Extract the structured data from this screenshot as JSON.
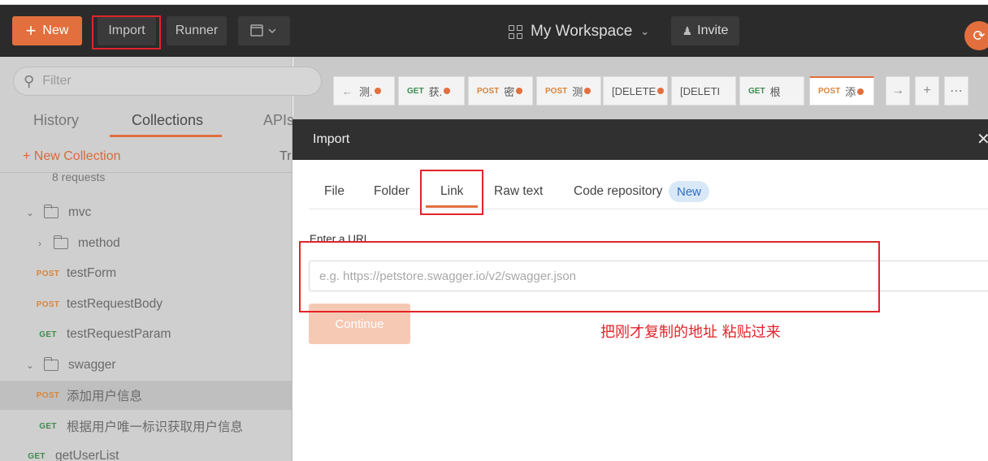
{
  "toolbar": {
    "new_label": "New",
    "import_label": "Import",
    "runner_label": "Runner",
    "workspace_label": "My Workspace",
    "invite_label": "Invite"
  },
  "sidebar": {
    "filter_placeholder": "Filter",
    "tabs": [
      "History",
      "Collections",
      "APIs"
    ],
    "new_collection_label": "+ New Collection",
    "trash_label": "Tr",
    "request_count": "8 requests",
    "items": [
      {
        "type": "folder",
        "label": "mvc",
        "expanded": true
      },
      {
        "type": "folder",
        "label": "method",
        "expanded": false
      },
      {
        "type": "request",
        "method": "POST",
        "label": "testForm"
      },
      {
        "type": "request",
        "method": "POST",
        "label": "testRequestBody"
      },
      {
        "type": "request",
        "method": "GET",
        "label": "testRequestParam"
      },
      {
        "type": "folder",
        "label": "swagger",
        "expanded": true
      },
      {
        "type": "request",
        "method": "POST",
        "label": "添加用户信息"
      },
      {
        "type": "request",
        "method": "GET",
        "label": "根据用户唯一标识获取用户信息"
      },
      {
        "type": "request",
        "method": "GET",
        "label": "getUserList"
      }
    ]
  },
  "request_tabs": [
    {
      "method": "",
      "label": "测."
    },
    {
      "method": "GET",
      "label": "获."
    },
    {
      "method": "POST",
      "label": "密"
    },
    {
      "method": "POST",
      "label": "测"
    },
    {
      "method": "",
      "label": "[DELETE"
    },
    {
      "method": "",
      "label": "[DELETI"
    },
    {
      "method": "GET",
      "label": "根"
    },
    {
      "method": "POST",
      "label": "添"
    }
  ],
  "modal": {
    "title": "Import",
    "tabs": [
      "File",
      "Folder",
      "Link",
      "Raw text",
      "Code repository"
    ],
    "new_badge": "New",
    "url_label": "Enter a URL",
    "url_placeholder": "e.g. https://petstore.swagger.io/v2/swagger.json",
    "continue_label": "Continue"
  },
  "annotation": "把刚才复制的地址 粘贴过来",
  "colors": {
    "accent": "#e26f3d",
    "topbar": "#2b2b2b",
    "annotation_red": "#e0242b",
    "badge_blue": "#2a6fc4"
  }
}
